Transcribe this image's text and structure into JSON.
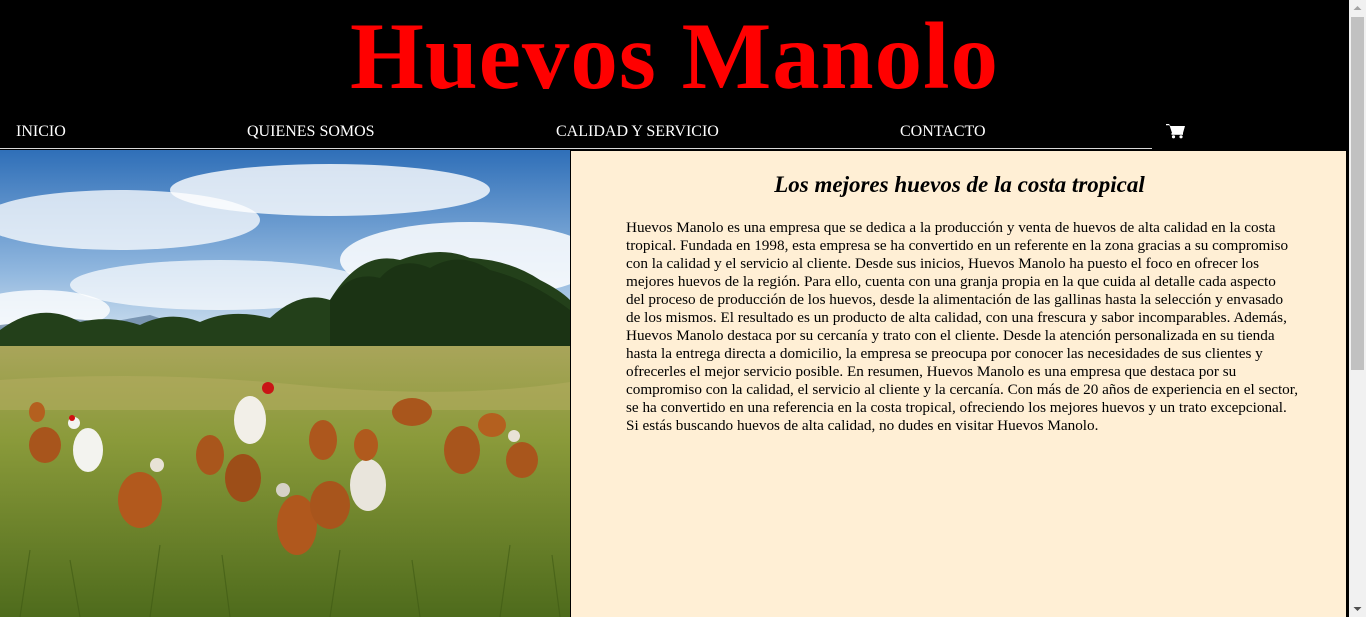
{
  "header": {
    "title": "Huevos Manolo"
  },
  "nav": {
    "items": [
      {
        "label": "INICIO"
      },
      {
        "label": "QUIENES SOMOS"
      },
      {
        "label": "CALIDAD Y SERVICIO"
      },
      {
        "label": "CONTACTO"
      }
    ],
    "cart_icon": "shopping-cart-icon"
  },
  "hero_image": {
    "subject": "chickens-in-grass-field"
  },
  "content": {
    "title": "Los mejores huevos de la costa tropical",
    "body": "Huevos Manolo es una empresa que se dedica a la producción y venta de huevos de alta calidad en la costa tropical. Fundada en 1998, esta empresa se ha convertido en un referente en la zona gracias a su compromiso con la calidad y el servicio al cliente. Desde sus inicios, Huevos Manolo ha puesto el foco en ofrecer los mejores huevos de la región. Para ello, cuenta con una granja propia en la que cuida al detalle cada aspecto del proceso de producción de los huevos, desde la alimentación de las gallinas hasta la selección y envasado de los mismos. El resultado es un producto de alta calidad, con una frescura y sabor incomparables. Además, Huevos Manolo destaca por su cercanía y trato con el cliente. Desde la atención personalizada en su tienda hasta la entrega directa a domicilio, la empresa se preocupa por conocer las necesidades de sus clientes y ofrecerles el mejor servicio posible. En resumen, Huevos Manolo es una empresa que destaca por su compromiso con la calidad, el servicio al cliente y la cercanía. Con más de 20 años de experiencia en el sector, se ha convertido en una referencia en la costa tropical, ofreciendo los mejores huevos y un trato excepcional. Si estás buscando huevos de alta calidad, no dudes en visitar Huevos Manolo."
  },
  "colors": {
    "title": "#ff0000",
    "header_bg": "#000000",
    "content_bg": "#ffefd5"
  }
}
